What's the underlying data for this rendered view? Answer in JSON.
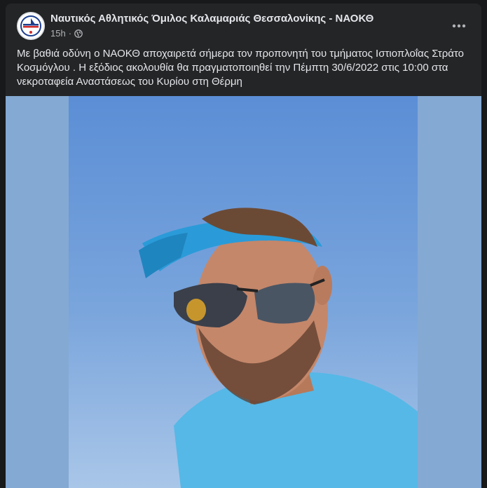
{
  "post": {
    "page_name": "Ναυτικός Αθλητικός Όμιλος Καλαμαριάς Θεσσαλονίκης - ΝΑΟΚΘ",
    "time": "15h",
    "separator": "·",
    "privacy_icon": "globe-icon",
    "more_icon": "more-options-icon",
    "text": "Με βαθιά οδύνη ο ΝΑΟΚΘ αποχαιρετά σήμερα τον προπονητή του τμήματος Ιστιοπλοΐας Στράτο Κοσμόγλου . Η εξόδιος ακολουθία θα πραγματοποιηθεί την Πέμπτη 30/6/2022 στις 10:00 στα νεκροταφεία Αναστάσεως του Κυρίου στη Θέρμη"
  },
  "colors": {
    "background": "#18191a",
    "card": "#242526",
    "primary_text": "#e4e6eb",
    "secondary_text": "#b0b3b8",
    "photo_border": "#84a9d3"
  }
}
